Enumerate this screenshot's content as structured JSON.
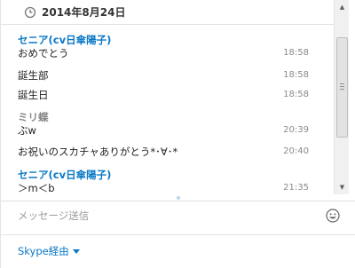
{
  "date_header": {
    "text": "2014年8月24日",
    "icon": "clock-icon"
  },
  "colors": {
    "sender_blue": "#0a78c6",
    "sender_gray": "#888888",
    "link_blue": "#0a78c6"
  },
  "messages": [
    {
      "sender": "セニア(cv日傘陽子)",
      "text": "おめでとう",
      "time": "18:58"
    },
    {
      "text": "誕生部",
      "time": "18:58"
    },
    {
      "text": "誕生日",
      "time": "18:58"
    },
    {
      "sender": "ミリ蝶",
      "text": "ぶw",
      "time": "20:39"
    },
    {
      "text": "お祝いのスカチャありがとう*･∀･*",
      "time": "20:40"
    },
    {
      "sender": "セニア(cv日傘陽子)",
      "text": "＞m＜b",
      "time": "21:35"
    }
  ],
  "input": {
    "placeholder": "メッセージ送信",
    "emoticon_icon": "smiley-icon"
  },
  "footer": {
    "via_label": "Skype経由"
  }
}
